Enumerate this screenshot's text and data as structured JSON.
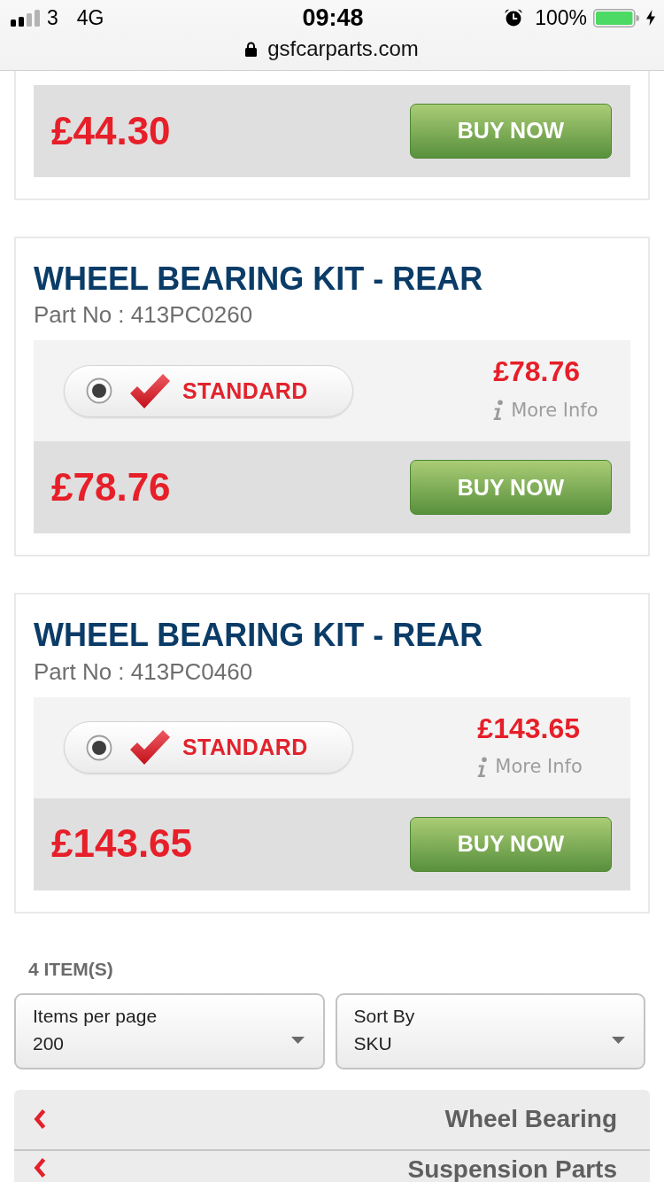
{
  "status_bar": {
    "carrier": "3",
    "network": "4G",
    "time": "09:48",
    "battery": "100%"
  },
  "address_bar": {
    "url": "gsfcarparts.com"
  },
  "products": [
    {
      "price": "£44.30",
      "buy_button": "BUY NOW"
    },
    {
      "title": "WHEEL BEARING KIT - REAR",
      "part_no": "Part No : 413PC0260",
      "options": [
        {
          "label": "STANDARD",
          "selected": true,
          "price": "£78.76",
          "more_info": "More Info"
        }
      ],
      "price": "£78.76",
      "buy_button": "BUY NOW"
    },
    {
      "title": "WHEEL BEARING KIT - REAR",
      "part_no": "Part No : 413PC0460",
      "options": [
        {
          "label": "STANDARD",
          "selected": true,
          "price": "£143.65",
          "more_info": "More Info"
        }
      ],
      "price": "£143.65",
      "buy_button": "BUY NOW"
    }
  ],
  "item_count": "4 ITEM(S)",
  "selects": [
    {
      "label": "Items per page",
      "value": "200"
    },
    {
      "label": "Sort By",
      "value": "SKU"
    }
  ],
  "categories": [
    {
      "label": "Wheel Bearing"
    },
    {
      "label": "Suspension Parts"
    }
  ]
}
